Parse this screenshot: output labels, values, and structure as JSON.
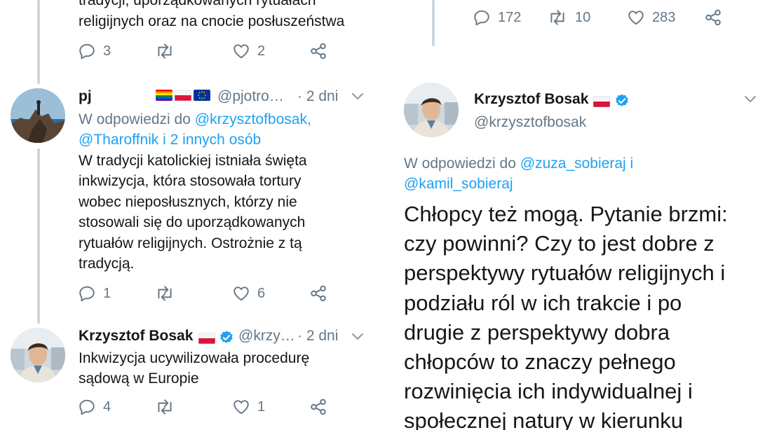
{
  "left": {
    "top_tweet": {
      "text_lines": [
        "tradycji, uporządkowanych rytuałach",
        "religijnych oraz na cnocie posłuszeństwa"
      ],
      "replies": "3",
      "likes": "2"
    },
    "tweet_pj": {
      "name": "pj",
      "handle": "@pjotro…",
      "time": "· 2 dni",
      "reply_prefix": "W odpowiedzi do",
      "reply_mention1": "@krzysztofbosak,",
      "reply_mention2": "@Tharoffnik i 2 innych osób",
      "text_lines": [
        "W tradycji katolickiej istniała święta",
        "inkwizycja, która stosowała tortury",
        "wobec nieposłusznych, którzy nie",
        "stosowali się do uporządkowanych",
        "rytuałów religijnych. Ostrożnie z tą",
        "tradycją."
      ],
      "replies": "1",
      "likes": "6"
    },
    "tweet_bosak": {
      "name": "Krzysztof Bosak",
      "handle": "@krzy…",
      "time": "· 2 dni",
      "text_lines": [
        "Inkwizycja ucywilizowała procedurę",
        "sądową w Europie"
      ],
      "replies": "4",
      "likes": "1"
    }
  },
  "right": {
    "top_stats": {
      "replies": "172",
      "retweets": "10",
      "likes": "283"
    },
    "author": {
      "name": "Krzysztof Bosak",
      "handle": "@krzysztofbosak"
    },
    "reply_prefix": "W odpowiedzi do",
    "reply_mention1": "@zuza_sobieraj i",
    "reply_mention2": "@kamil_sobieraj",
    "text_lines": [
      "Chłopcy też mogą. Pytanie brzmi:",
      "czy powinni? Czy to jest dobre z",
      "perspektywy rytuałów religijnych i",
      "podziału ról w ich trakcie i po",
      "drugie z perspektywy dobra",
      "chłopców to znaczy pełnego",
      "rozwinięcia ich indywidualnej i",
      "społecznej natury w kierunku"
    ]
  },
  "colors": {
    "text": "#14171a",
    "muted": "#657786",
    "link": "#1da1f2",
    "thread_line": "#ccd6dd",
    "verified": "#1da1f2"
  },
  "icons": [
    "reply-icon",
    "retweet-icon",
    "like-icon",
    "share-icon",
    "chevron-down-icon",
    "verified-icon",
    "flag-poland-icon",
    "flag-rainbow-icon",
    "flag-eu-icon"
  ]
}
